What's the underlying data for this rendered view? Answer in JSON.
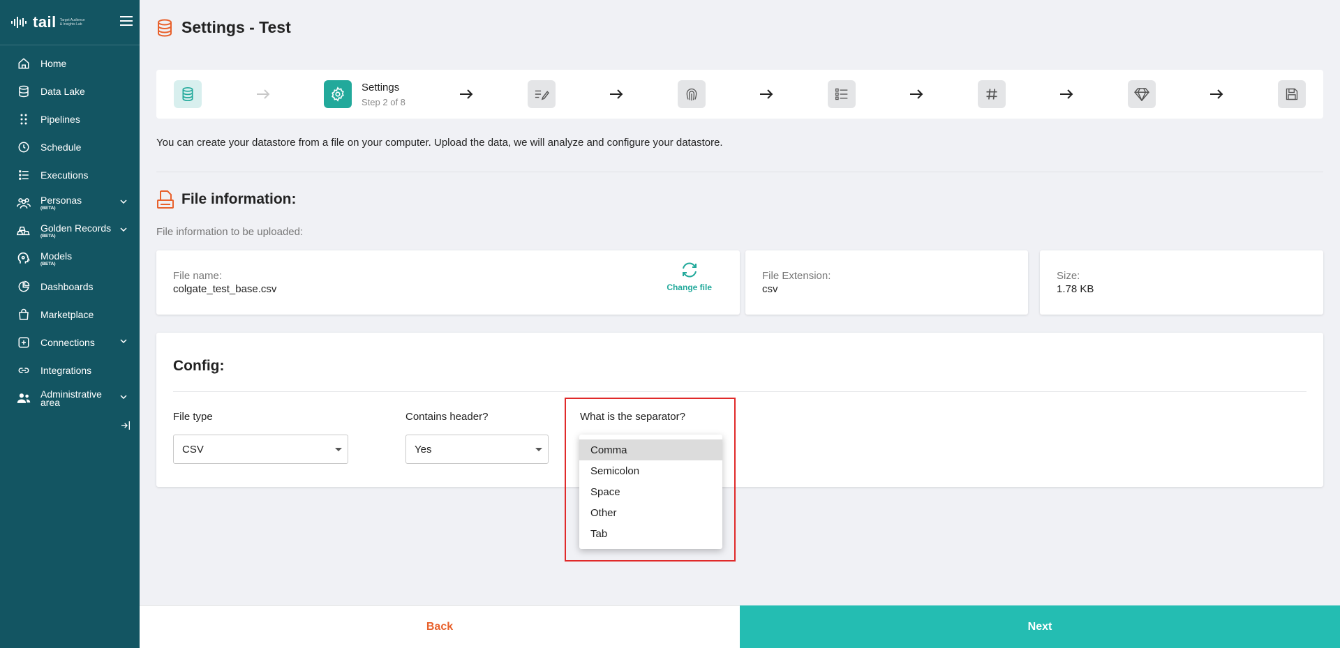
{
  "brand": {
    "name": "tail",
    "tagline": "Target Audience & Insights Lab"
  },
  "sidebar": {
    "items": [
      {
        "label": "Home",
        "icon": "home-icon"
      },
      {
        "label": "Data Lake",
        "icon": "database-icon"
      },
      {
        "label": "Pipelines",
        "icon": "pipelines-icon"
      },
      {
        "label": "Schedule",
        "icon": "clock-icon"
      },
      {
        "label": "Executions",
        "icon": "list-icon"
      },
      {
        "label": "Personas",
        "badge": "(BETA)",
        "icon": "people-icon",
        "expandable": true
      },
      {
        "label": "Golden Records",
        "badge": "(BETA)",
        "icon": "gold-bars-icon",
        "expandable": true
      },
      {
        "label": "Models",
        "badge": "(BETA)",
        "icon": "brain-head-icon"
      },
      {
        "label": "Dashboards",
        "icon": "pie-chart-icon"
      },
      {
        "label": "Marketplace",
        "icon": "shopping-bag-icon"
      },
      {
        "label": "Connections",
        "icon": "connections-icon",
        "expandable": true
      },
      {
        "label": "Integrations",
        "icon": "link-icon"
      },
      {
        "label": "Administrative area",
        "icon": "admin-users-icon",
        "expandable": true
      }
    ]
  },
  "page": {
    "title": "Settings - Test"
  },
  "stepper": {
    "active_name": "Settings",
    "active_sub": "Step 2 of 8"
  },
  "intro": "You can create your datastore from a file on your computer. Upload the data, we will analyze and configure your datastore.",
  "file_info": {
    "title": "File information:",
    "subtitle": "File information to be uploaded:",
    "name_label": "File name:",
    "name_value": "colgate_test_base.csv",
    "change_label": "Change file",
    "ext_label": "File Extension:",
    "ext_value": "csv",
    "size_label": "Size:",
    "size_value": "1.78 KB"
  },
  "config": {
    "title": "Config:",
    "file_type_label": "File type",
    "file_type_value": "CSV",
    "header_label": "Contains header?",
    "header_value": "Yes",
    "separator_label": "What is the separator?",
    "separator_options": [
      "Comma",
      "Semicolon",
      "Space",
      "Other",
      "Tab"
    ],
    "separator_selected": "Comma"
  },
  "footer": {
    "back": "Back",
    "next": "Next"
  },
  "colors": {
    "sidebar": "#135562",
    "accent": "#22a99b",
    "next": "#24bdb2",
    "back_text": "#e8612c",
    "highlight": "#e02a2a"
  }
}
